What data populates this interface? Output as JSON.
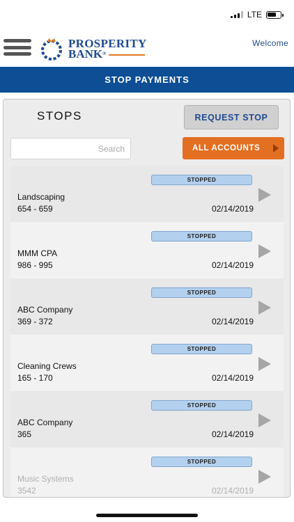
{
  "status_bar": {
    "network": "LTE"
  },
  "header": {
    "logo_line1": "PROSPERITY",
    "logo_line2": "BANK",
    "welcome": "Welcome"
  },
  "banner": {
    "title": "STOP PAYMENTS"
  },
  "panel": {
    "title": "STOPS",
    "request_button": "REQUEST STOP",
    "search_placeholder": "Search",
    "accounts_button": "ALL ACCOUNTS"
  },
  "stops": [
    {
      "status": "STOPPED",
      "payee": "Landscaping",
      "range": "654 - 659",
      "date": "02/14/2019"
    },
    {
      "status": "STOPPED",
      "payee": "MMM CPA",
      "range": "986 - 995",
      "date": "02/14/2019"
    },
    {
      "status": "STOPPED",
      "payee": "ABC Company",
      "range": "369 - 372",
      "date": "02/14/2019"
    },
    {
      "status": "STOPPED",
      "payee": "Cleaning Crews",
      "range": "165 - 170",
      "date": "02/14/2019"
    },
    {
      "status": "STOPPED",
      "payee": "ABC Company",
      "range": "365",
      "date": "02/14/2019"
    },
    {
      "status": "STOPPED",
      "payee": "Music Systems",
      "range": "3542",
      "date": "02/14/2019"
    }
  ],
  "colors": {
    "brand_blue": "#0d4e94",
    "accent_orange": "#e36f22",
    "badge_blue": "#b3d0ee"
  },
  "icons": [
    "hamburger-menu-icon",
    "bank-logo-icon",
    "signal-icon",
    "battery-icon",
    "triangle-right-icon"
  ]
}
